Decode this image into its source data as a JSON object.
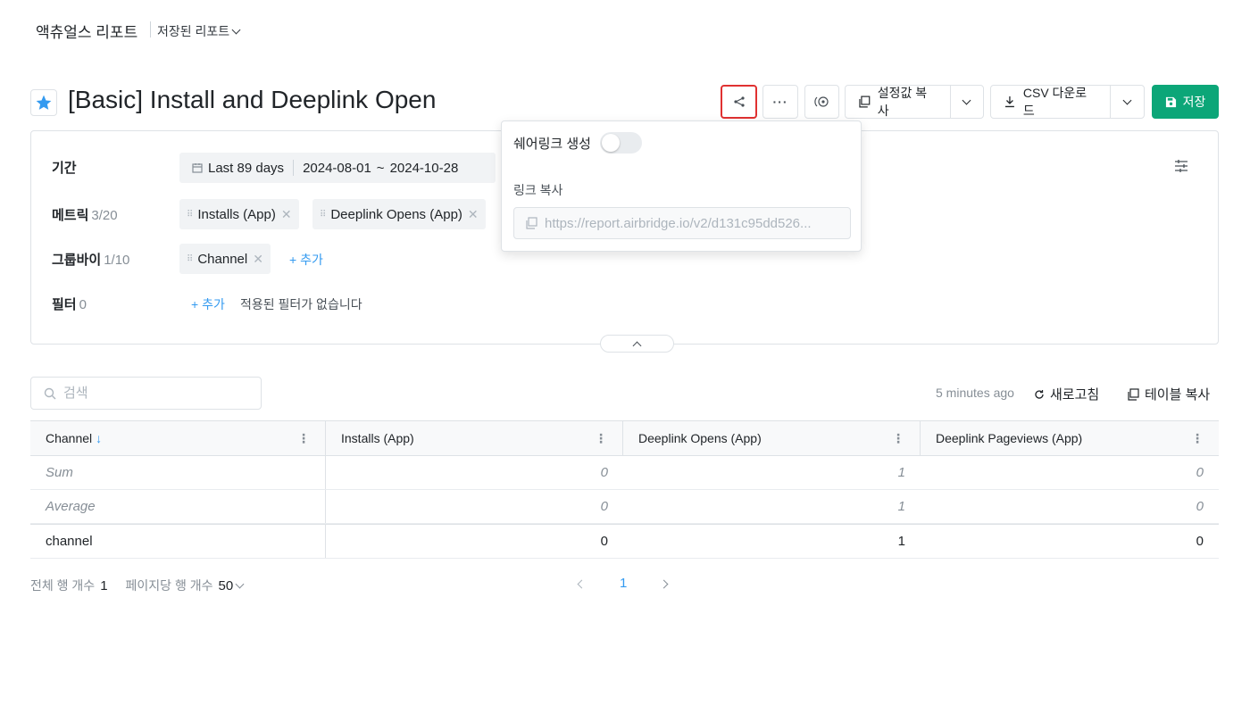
{
  "breadcrumb": {
    "app_title": "액츄얼스 리포트",
    "saved_reports": "저장된 리포트"
  },
  "report": {
    "title": "[Basic] Install and Deeplink Open"
  },
  "toolbar": {
    "copy_settings": "설정값 복사",
    "csv_download": "CSV 다운로드",
    "save": "저장"
  },
  "share_popover": {
    "create_label": "쉐어링크 생성",
    "toggle_on": false,
    "copy_label": "링크 복사",
    "link_value": "https://report.airbridge.io/v2/d131c95dd526..."
  },
  "filters": {
    "period": {
      "label": "기간",
      "preset": "Last 89 days",
      "start": "2024-08-01",
      "tilde": "~",
      "end": "2024-10-28"
    },
    "metrics": {
      "label": "메트릭",
      "count": "3/20",
      "items": [
        "Installs (App)",
        "Deeplink Opens (App)"
      ]
    },
    "groupby": {
      "label": "그룹바이",
      "count": "1/10",
      "items": [
        "Channel"
      ],
      "add": "+ 추가"
    },
    "filter": {
      "label": "필터",
      "count": "0",
      "add": "+ 추가",
      "empty_text": "적용된 필터가 없습니다"
    }
  },
  "table_tools": {
    "search_placeholder": "검색",
    "updated": "5 minutes ago",
    "refresh": "새로고침",
    "copy_table": "테이블 복사"
  },
  "table": {
    "columns": [
      "Channel",
      "Installs (App)",
      "Deeplink Opens (App)",
      "Deeplink Pageviews (App)"
    ],
    "sort_indicator": "↓",
    "summary_rows": [
      {
        "label": "Sum",
        "values": [
          "0",
          "1",
          "0"
        ]
      },
      {
        "label": "Average",
        "values": [
          "0",
          "1",
          "0"
        ]
      }
    ],
    "rows": [
      {
        "label": "channel",
        "values": [
          "0",
          "1",
          "0"
        ]
      }
    ]
  },
  "pagination": {
    "total_rows_label": "전체 행 개수",
    "total_rows": "1",
    "per_page_label": "페이지당 행 개수",
    "per_page": "50",
    "current_page": "1"
  },
  "colors": {
    "accent": "#339af0",
    "save_green": "#0ca678",
    "highlight_red": "#e03131"
  }
}
